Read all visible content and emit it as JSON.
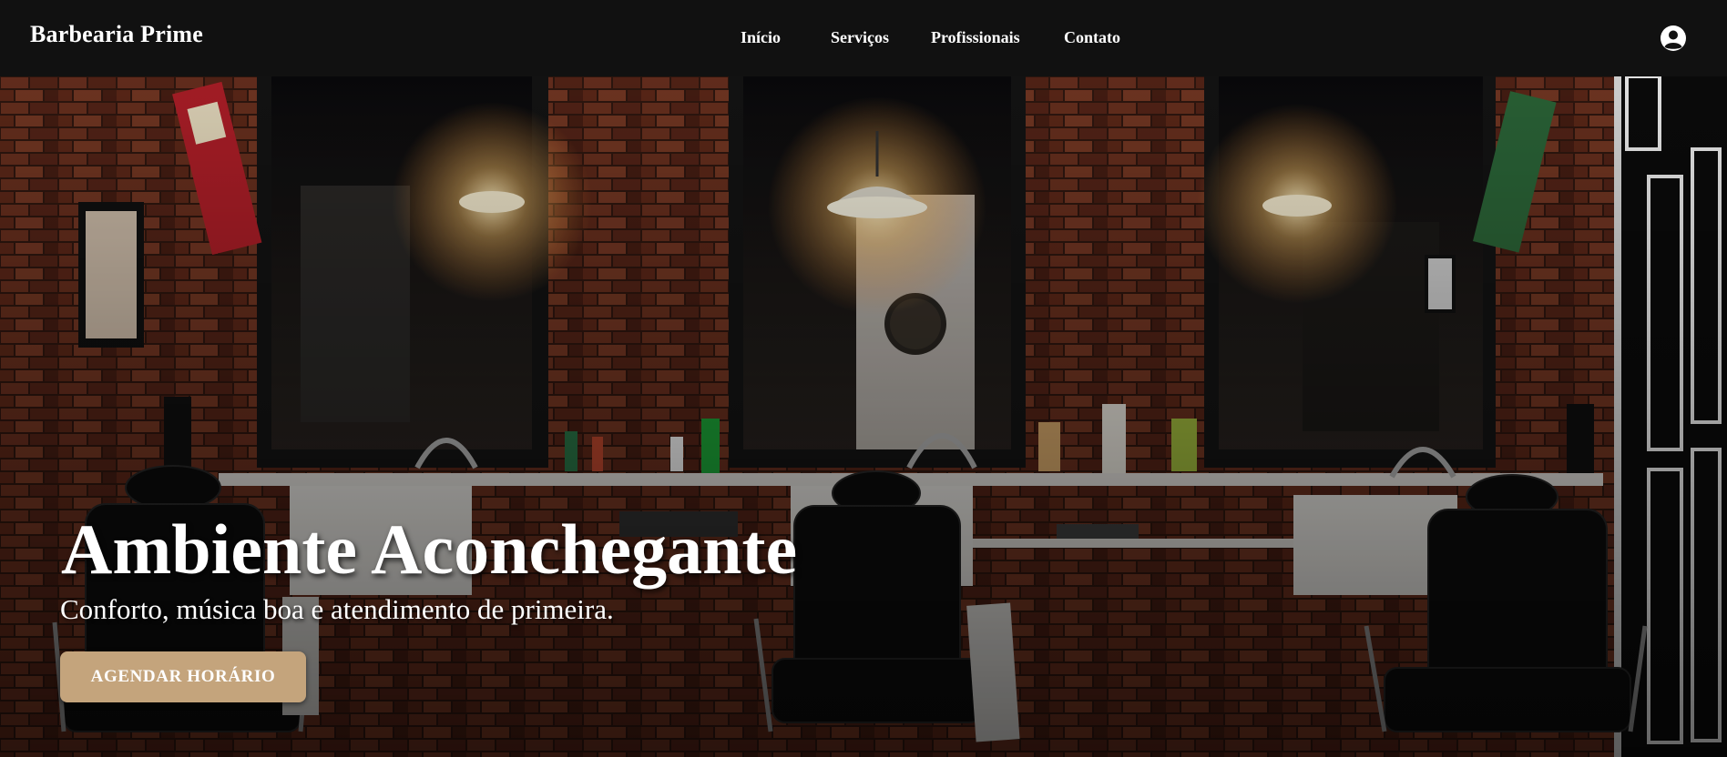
{
  "brand": {
    "name": "Barbearia Prime"
  },
  "nav": {
    "links": [
      {
        "label": "Início"
      },
      {
        "label": "Serviços"
      },
      {
        "label": "Profissionais"
      },
      {
        "label": "Contato"
      }
    ],
    "account_icon": "user-circle-icon"
  },
  "hero": {
    "title": "Ambiente Aconchegante",
    "subtitle": "Conforto, música boa e atendimento de primeira.",
    "cta_label": "AGENDAR HORÁRIO",
    "image": "barbershop-interior-photo"
  },
  "colors": {
    "navbar_bg": "#111111",
    "cta_bg": "#c4a47c",
    "text": "#ffffff",
    "brick": "#8a3f2a"
  }
}
